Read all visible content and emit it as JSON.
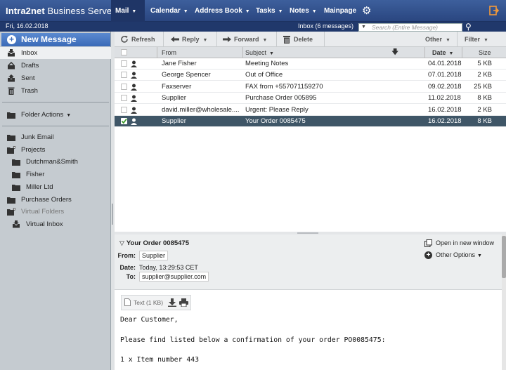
{
  "app": {
    "brand_bold": "Intra2net",
    "brand_rest": "Business Server",
    "menu": [
      {
        "label": "Mail",
        "has_caret": true,
        "active": true
      },
      {
        "label": "Calendar",
        "has_caret": true
      },
      {
        "label": "Address Book",
        "has_caret": true
      },
      {
        "label": "Tasks",
        "has_caret": true
      },
      {
        "label": "Notes",
        "has_caret": true
      },
      {
        "label": "Mainpage",
        "has_caret": false
      }
    ],
    "date": "Fri, 16.02.2018",
    "folder_status": "Inbox (6 messages)",
    "search_placeholder": "Search (Entire Message)"
  },
  "sidebar": {
    "new_message": "New Message",
    "system_folders": [
      {
        "label": "Inbox",
        "icon": "inbox-icon",
        "selected": true
      },
      {
        "label": "Drafts",
        "icon": "drafts-icon"
      },
      {
        "label": "Sent",
        "icon": "sent-icon"
      },
      {
        "label": "Trash",
        "icon": "trash-icon"
      }
    ],
    "folder_actions": "Folder Actions",
    "user_folders": [
      {
        "label": "Junk Email",
        "icon": "folder-icon"
      },
      {
        "label": "Projects",
        "icon": "folder-open-icon"
      },
      {
        "label": "Dutchman&Smith",
        "icon": "folder-icon",
        "sub": true
      },
      {
        "label": "Fisher",
        "icon": "folder-icon",
        "sub": true
      },
      {
        "label": "Miller Ltd",
        "icon": "folder-icon",
        "sub": true
      },
      {
        "label": "Purchase Orders",
        "icon": "folder-icon"
      },
      {
        "label": "Virtual Folders",
        "icon": "folder-open-icon",
        "dim": true
      },
      {
        "label": "Virtual Inbox",
        "icon": "virtual-inbox-icon",
        "sub": true
      }
    ]
  },
  "toolbar": {
    "refresh": "Refresh",
    "reply": "Reply",
    "forward": "Forward",
    "delete": "Delete",
    "other": "Other",
    "filter": "Filter"
  },
  "columns": {
    "from": "From",
    "subject": "Subject",
    "date": "Date",
    "size": "Size"
  },
  "messages": [
    {
      "from": "Jane Fisher",
      "subject": "Meeting Notes",
      "date": "04.01.2018",
      "size": "5 KB",
      "selected": false
    },
    {
      "from": "George Spencer",
      "subject": "Out of Office",
      "date": "07.01.2018",
      "size": "2 KB",
      "selected": false
    },
    {
      "from": "Faxserver",
      "subject": "FAX from +557071159270",
      "date": "09.02.2018",
      "size": "25 KB",
      "selected": false
    },
    {
      "from": "Supplier",
      "subject": "Purchase Order 005895",
      "date": "11.02.2018",
      "size": "8 KB",
      "selected": false
    },
    {
      "from": "david.miller@wholesale....",
      "subject": "Urgent: Please Reply",
      "date": "16.02.2018",
      "size": "2 KB",
      "selected": false
    },
    {
      "from": "Supplier",
      "subject": "Your Order 0085475",
      "date": "16.02.2018",
      "size": "8 KB",
      "selected": true
    }
  ],
  "preview": {
    "subject": "Your Order 0085475",
    "from_label": "From:",
    "from_value": "Supplier",
    "date_label": "Date:",
    "date_value": "Today, 13:29:53 CET",
    "to_label": "To:",
    "to_value": "supplier@supplier.com",
    "open_new_window": "Open in new window",
    "other_options": "Other Options",
    "attachment": "Text (1 KB)",
    "body_lines": [
      "Dear Customer,",
      "",
      "Please find listed below a confirmation of your order PO0085475:",
      "",
      "1 x Item number 443"
    ]
  }
}
